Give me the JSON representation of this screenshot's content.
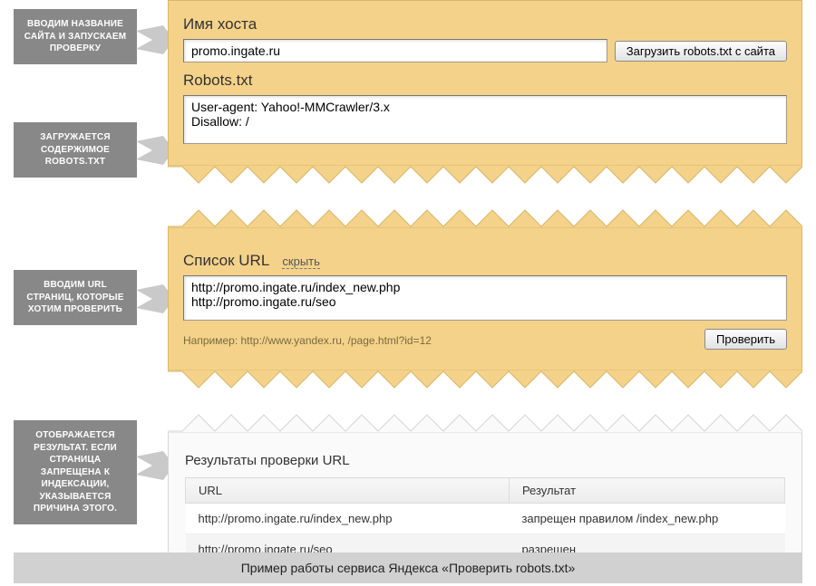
{
  "callouts": {
    "c1": "ВВОДИМ НАЗВАНИЕ САЙТА И ЗАПУСКАЕМ ПРОВЕРКУ",
    "c2": "ЗАГРУЖАЕТСЯ СОДЕРЖИМОЕ ROBOTS.TXT",
    "c3": "ВВОДИМ URL СТРАНИЦ, КОТОРЫЕ ХОТИМ ПРОВЕРИТЬ",
    "c4": "ОТОБРАЖАЕТСЯ РЕЗУЛЬТАТ. ЕСЛИ СТРАНИЦА ЗАПРЕЩЕНА К ИНДЕКСАЦИИ, УКАЗЫВАЕТСЯ ПРИЧИНА ЭТОГО."
  },
  "host": {
    "label": "Имя хоста",
    "value": "promo.ingate.ru",
    "load_btn": "Загрузить robots.txt с сайта"
  },
  "robots": {
    "label": "Robots.txt",
    "content": "User-agent: Yahoo!-MMCrawler/3.x\nDisallow: /"
  },
  "urls": {
    "label": "Список URL",
    "hide": "скрыть",
    "content": "http://promo.ingate.ru/index_new.php\nhttp://promo.ingate.ru/seo",
    "example": "Например: http://www.yandex.ru, /page.html?id=12",
    "check_btn": "Проверить"
  },
  "results": {
    "title": "Результаты проверки URL",
    "col_url": "URL",
    "col_result": "Результат",
    "rows": [
      {
        "url": "http://promo.ingate.ru/index_new.php",
        "result": "запрещен правилом /index_new.php",
        "status": "denied"
      },
      {
        "url": "http://promo.ingate.ru/seo",
        "result": "разрешен",
        "status": "allowed"
      }
    ]
  },
  "caption": "Пример работы сервиса Яндекса «Проверить robots.txt»"
}
